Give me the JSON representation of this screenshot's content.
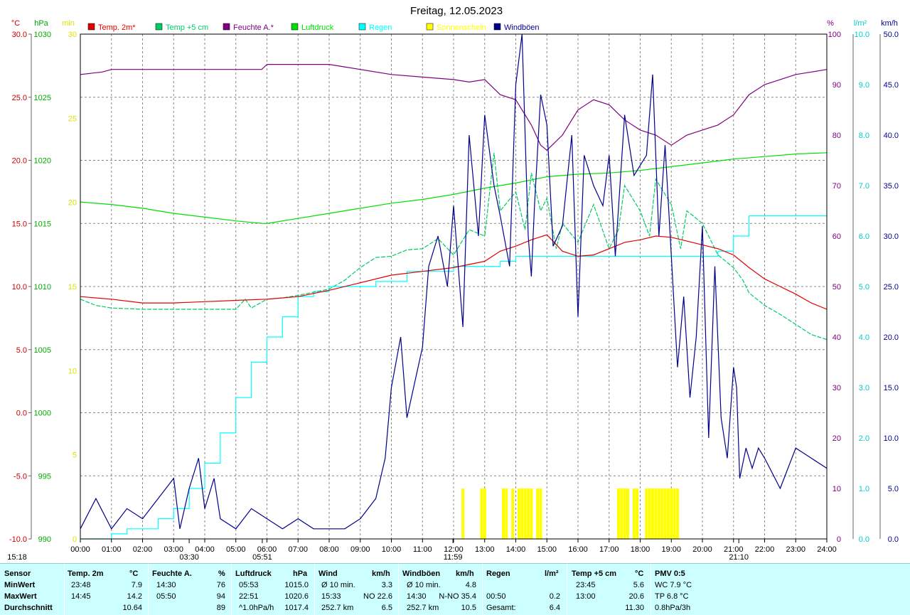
{
  "title": "Freitag, 12.05.2023",
  "legend": [
    {
      "label": "Temp. 2m*",
      "color": "#e00000"
    },
    {
      "label": "Temp +5 cm",
      "color": "#00cc66"
    },
    {
      "label": "Feuchte A.*",
      "color": "#800080"
    },
    {
      "label": "Luftdruck",
      "color": "#00dd00"
    },
    {
      "label": "Regen",
      "color": "#00ffff"
    },
    {
      "label": "Sonnenschein",
      "color": "#ffff00"
    },
    {
      "label": "Windböen",
      "color": "#00008b"
    }
  ],
  "axes": {
    "temp": {
      "unit": "°C",
      "ticks": [
        "30.0",
        "25.0",
        "20.0",
        "15.0",
        "10.0",
        "5.0",
        "0.0",
        "-5.0",
        "-10.0"
      ],
      "color": "#cc0000"
    },
    "pressure": {
      "unit": "hPa",
      "ticks": [
        "1030",
        "1025",
        "1020",
        "1015",
        "1010",
        "1005",
        "1000",
        "995",
        "990"
      ],
      "color": "#00aa00"
    },
    "sun": {
      "unit": "min",
      "ticks": [
        "30",
        "25",
        "20",
        "15",
        "10",
        "5",
        "0"
      ],
      "color": "#e0e000"
    },
    "humidity": {
      "unit": "%",
      "ticks": [
        "100",
        "90",
        "80",
        "70",
        "60",
        "50",
        "40",
        "30",
        "20",
        "10",
        "0"
      ],
      "color": "#800080"
    },
    "rain": {
      "unit": "l/m²",
      "ticks": [
        "10.0",
        "9.0",
        "8.0",
        "7.0",
        "6.0",
        "5.0",
        "4.0",
        "3.0",
        "2.0",
        "1.0",
        "0.0"
      ],
      "color": "#00cccc"
    },
    "wind": {
      "unit": "km/h",
      "ticks": [
        "50.0",
        "45.0",
        "40.0",
        "35.0",
        "30.0",
        "25.0",
        "20.0",
        "15.0",
        "10.0",
        "5.0",
        "0.0"
      ],
      "color": "#00008b"
    },
    "x_ticks": [
      "00:00",
      "01:00",
      "02:00",
      "03:00",
      "04:00",
      "05:00",
      "06:00",
      "07:00",
      "08:00",
      "09:00",
      "10:00",
      "11:00",
      "12:00",
      "13:00",
      "14:00",
      "15:00",
      "16:00",
      "17:00",
      "18:00",
      "19:00",
      "20:00",
      "21:00",
      "22:00",
      "23:00",
      "24:00"
    ]
  },
  "markers": [
    {
      "label": "15:18",
      "hour": 0.0
    },
    {
      "label": "03:30",
      "hour": 3.5
    },
    {
      "label": "05:51",
      "hour": 5.85
    },
    {
      "label": "11:59",
      "hour": 11.98
    },
    {
      "label": "21:10",
      "hour": 21.17
    }
  ],
  "chart_data": {
    "type": "line",
    "title": "Freitag, 12.05.2023",
    "x_unit": "hour",
    "xlim": [
      0,
      24
    ],
    "series": [
      {
        "name": "Temp. 2m*",
        "axis": "temp",
        "ylim": [
          -10,
          30
        ],
        "color": "#e00000",
        "x": [
          0,
          1,
          2,
          3,
          4,
          5,
          6,
          7,
          8,
          9,
          10,
          11,
          12,
          13,
          13.5,
          14,
          14.5,
          15,
          15.5,
          16,
          16.5,
          17,
          17.5,
          18,
          18.5,
          19,
          19.5,
          20,
          20.5,
          21,
          21.5,
          22,
          22.5,
          23,
          23.5,
          24
        ],
        "y": [
          9.2,
          9.0,
          8.7,
          8.7,
          8.8,
          8.9,
          9.0,
          9.2,
          9.7,
          10.3,
          10.9,
          11.2,
          11.5,
          12.0,
          12.8,
          13.2,
          13.7,
          14.1,
          12.8,
          12.4,
          12.5,
          13.0,
          13.5,
          13.7,
          14.0,
          13.9,
          13.6,
          13.3,
          13.0,
          12.5,
          11.5,
          10.6,
          10.0,
          9.4,
          8.7,
          8.2
        ]
      },
      {
        "name": "Temp +5 cm",
        "axis": "temp",
        "ylim": [
          -10,
          30
        ],
        "color": "#00cc66",
        "x": [
          0,
          0.5,
          1,
          2,
          3,
          4,
          5,
          5.3,
          5.5,
          6,
          6.5,
          7,
          8,
          8.5,
          9,
          9.5,
          10,
          10.5,
          11,
          11.5,
          12,
          12.5,
          13,
          13.3,
          13.5,
          14,
          14.3,
          14.5,
          14.8,
          15,
          15.3,
          15.5,
          16,
          16.5,
          17,
          17.3,
          17.5,
          18,
          18.3,
          18.5,
          19,
          19.3,
          19.5,
          20,
          20.3,
          20.5,
          21,
          21.3,
          21.5,
          22,
          22.5,
          23,
          23.5,
          24
        ],
        "y": [
          9.0,
          8.5,
          8.3,
          8.2,
          8.2,
          8.2,
          8.2,
          9.0,
          8.3,
          9.0,
          9.1,
          9.3,
          9.8,
          10.5,
          11.5,
          12.3,
          12.4,
          12.9,
          13.0,
          13.8,
          12.5,
          14.5,
          14.0,
          20.6,
          16.0,
          17.5,
          14.5,
          19.0,
          16.0,
          17.0,
          13.0,
          15.0,
          13.5,
          16.5,
          13.0,
          14.5,
          18.0,
          16.0,
          14.0,
          18.5,
          16.5,
          13.0,
          16.0,
          15.0,
          13.5,
          12.5,
          11.5,
          10.5,
          9.5,
          8.5,
          7.8,
          7.0,
          6.2,
          5.8
        ]
      },
      {
        "name": "Feuchte A.*",
        "axis": "humidity",
        "ylim": [
          0,
          100
        ],
        "color": "#800080",
        "x": [
          0,
          0.7,
          1,
          2,
          3,
          4,
          5,
          5.83,
          6,
          7,
          8,
          8.5,
          9,
          10,
          11,
          12,
          12.5,
          13,
          13.5,
          14,
          14.5,
          14.8,
          15,
          15.5,
          16,
          16.5,
          17,
          17.5,
          18,
          18.5,
          19,
          19.5,
          20,
          20.5,
          21,
          21.5,
          22,
          22.5,
          23,
          23.5,
          24
        ],
        "y": [
          92,
          92.5,
          93,
          93,
          93,
          93,
          93,
          93,
          94,
          94,
          94,
          93.5,
          93,
          92,
          91.5,
          91,
          90.5,
          91,
          88,
          87,
          82,
          78,
          77,
          80,
          85,
          87,
          86,
          83,
          81,
          80,
          78,
          80,
          81,
          82,
          84,
          88,
          90,
          91,
          92,
          92.5,
          93
        ]
      },
      {
        "name": "Luftdruck",
        "axis": "pressure",
        "ylim": [
          990,
          1030
        ],
        "color": "#00dd00",
        "x": [
          0,
          1,
          2,
          3,
          4,
          5,
          5.88,
          6,
          7,
          8,
          9,
          10,
          11,
          12,
          13,
          14,
          15,
          16,
          17,
          18,
          19,
          20,
          21,
          22,
          23,
          24
        ],
        "y": [
          1016.7,
          1016.5,
          1016.2,
          1015.8,
          1015.5,
          1015.2,
          1015.0,
          1015.0,
          1015.4,
          1015.8,
          1016.2,
          1016.6,
          1016.9,
          1017.3,
          1017.8,
          1018.2,
          1018.7,
          1018.9,
          1019.0,
          1019.2,
          1019.5,
          1019.8,
          1020.1,
          1020.3,
          1020.5,
          1020.6
        ]
      },
      {
        "name": "Regen",
        "axis": "rain",
        "ylim": [
          0,
          10
        ],
        "color": "#00ffff",
        "x": [
          0,
          0.5,
          1,
          1.5,
          2,
          2.5,
          3,
          3.5,
          4,
          4.5,
          5,
          5.5,
          6,
          6.5,
          7,
          7.5,
          8,
          8.5,
          9,
          9.5,
          10,
          10.5,
          11,
          12,
          13,
          13.5,
          14,
          15,
          16,
          17,
          18,
          19,
          20,
          20.5,
          21,
          21.5,
          22,
          23,
          24
        ],
        "y": [
          0.0,
          0.0,
          0.1,
          0.2,
          0.2,
          0.4,
          0.6,
          1.0,
          1.5,
          2.1,
          2.8,
          3.5,
          4.0,
          4.4,
          4.8,
          4.9,
          5.0,
          5.0,
          5.0,
          5.1,
          5.1,
          5.3,
          5.3,
          5.4,
          5.4,
          5.5,
          5.6,
          5.6,
          5.6,
          5.6,
          5.6,
          5.6,
          5.6,
          5.7,
          6.0,
          6.4,
          6.4,
          6.4,
          6.4
        ]
      },
      {
        "name": "Sonnenschein",
        "axis": "sun",
        "ylim": [
          0,
          30
        ],
        "color": "#ffff00",
        "x": [
          12.3,
          12.9,
          13.0,
          13.6,
          13.7,
          13.9,
          14.1,
          14.2,
          14.3,
          14.4,
          14.5,
          14.7,
          14.8,
          17.3,
          17.4,
          17.5,
          17.6,
          17.8,
          17.9,
          18.2,
          18.3,
          18.4,
          18.5,
          18.6,
          18.7,
          18.8,
          18.9,
          19.0,
          19.1,
          19.2
        ],
        "y": [
          3,
          3,
          3,
          3,
          3,
          3,
          3,
          3,
          3,
          3,
          3,
          3,
          3,
          3,
          3,
          3,
          3,
          3,
          3,
          3,
          3,
          3,
          3,
          3,
          3,
          3,
          3,
          3,
          3,
          3
        ]
      },
      {
        "name": "Windböen",
        "axis": "wind",
        "ylim": [
          0,
          50
        ],
        "color": "#00008b",
        "x": [
          0,
          0.5,
          1,
          1.5,
          2,
          2.5,
          3,
          3.2,
          3.5,
          3.8,
          4,
          4.3,
          4.5,
          5,
          5.5,
          6,
          6.5,
          7,
          7.5,
          8,
          8.5,
          9,
          9.5,
          9.8,
          10,
          10.3,
          10.5,
          11,
          11.2,
          11.5,
          11.8,
          12,
          12.3,
          12.5,
          12.8,
          13,
          13.3,
          13.5,
          13.8,
          14,
          14.2,
          14.4,
          14.5,
          14.6,
          14.8,
          15,
          15.2,
          15.5,
          15.8,
          16,
          16.2,
          16.5,
          16.8,
          17,
          17.2,
          17.5,
          17.8,
          18,
          18.2,
          18.4,
          18.6,
          18.8,
          19,
          19.2,
          19.4,
          19.6,
          19.8,
          20,
          20.2,
          20.4,
          20.6,
          20.8,
          21,
          21.1,
          21.2,
          21.4,
          21.6,
          21.8,
          22,
          22.5,
          23,
          23.5,
          24
        ],
        "y": [
          1,
          4,
          1,
          3,
          2,
          4,
          6,
          1,
          5,
          8,
          3,
          6,
          2,
          1,
          3,
          2,
          1,
          2,
          1,
          1,
          1,
          2,
          4,
          8,
          15,
          20,
          12,
          19,
          27,
          30,
          25,
          33,
          21,
          40,
          30,
          42,
          35,
          32,
          27,
          45,
          50,
          30,
          26,
          33,
          44,
          41,
          29,
          31,
          40,
          22,
          38,
          35,
          33,
          38,
          28,
          42,
          36,
          37,
          38,
          46,
          30,
          39,
          28,
          17,
          24,
          14,
          20,
          31,
          10,
          27,
          12,
          8,
          17,
          15,
          6,
          9,
          7,
          9,
          8,
          5,
          9,
          8,
          7
        ]
      }
    ]
  },
  "stats": {
    "headers": {
      "sensor": "Sensor",
      "temp2m": "Temp. 2m",
      "temp2m_unit": "°C",
      "feuchte": "Feuchte A.",
      "feuchte_unit": "%",
      "luftdruck": "Luftdruck",
      "luftdruck_unit": "hPa",
      "wind": "Wind",
      "wind_unit": "km/h",
      "windboeen": "Windböen",
      "windboeen_unit": "km/h",
      "regen": "Regen",
      "regen_unit": "l/m²",
      "temp5": "Temp +5 cm",
      "temp5_unit": "°C",
      "pmv": "PMV 0:5"
    },
    "rows": [
      {
        "label": "MinWert",
        "t2_time": "23:48",
        "t2_val": "7.9",
        "f_time": "14:30",
        "f_val": "76",
        "l_time": "05:53",
        "l_val": "1015.0",
        "w_time": "Ø 10 min.",
        "w_val": "3.3",
        "wb_time": "Ø 10 min.",
        "wb_val": "4.8",
        "r_time": "",
        "r_val": "",
        "t5_time": "23:45",
        "t5_val": "5.6",
        "pmv": "WC 7.9 °C"
      },
      {
        "label": "MaxWert",
        "t2_time": "14:45",
        "t2_val": "14.2",
        "f_time": "05:50",
        "f_val": "94",
        "l_time": "22:51",
        "l_val": "1020.6",
        "w_time": "15:33",
        "w_val": "NO 22.6",
        "wb_time": "14:30",
        "wb_val": "N-NO 35.4",
        "r_time": "00:50",
        "r_val": "0.2",
        "t5_time": "13:00",
        "t5_val": "20.6",
        "pmv": "TP 6.8 °C"
      },
      {
        "label": "Durchschnitt",
        "t2_time": "",
        "t2_val": "10.64",
        "f_time": "",
        "f_val": "89",
        "l_time": "^1.0hPa/h",
        "l_val": "1017.4",
        "w_time": "252.7 km",
        "w_val": "6.5",
        "wb_time": "252.7 km",
        "wb_val": "10.5",
        "r_time": "Gesamt:",
        "r_val": "6.4",
        "t5_time": "",
        "t5_val": "11.30",
        "pmv": "0.8hPa/3h"
      }
    ]
  }
}
